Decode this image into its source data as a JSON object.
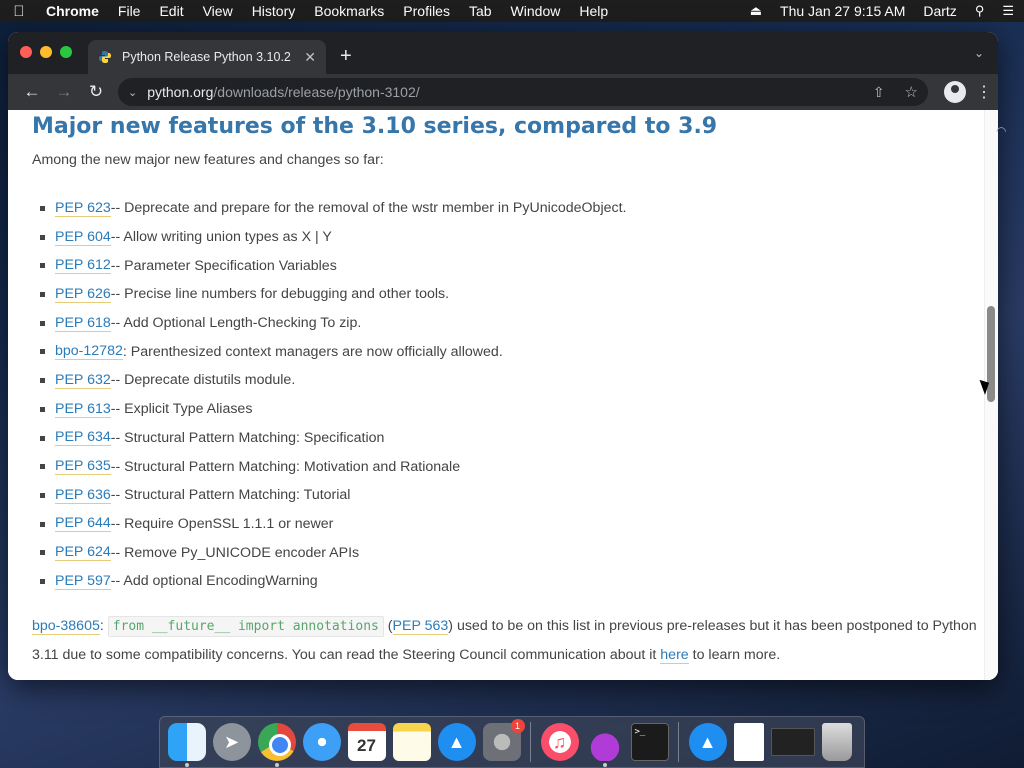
{
  "menubar": {
    "app_name": "Chrome",
    "menus": [
      "File",
      "Edit",
      "View",
      "History",
      "Bookmarks",
      "Profiles",
      "Tab",
      "Window",
      "Help"
    ],
    "datetime": "Thu Jan 27  9:15 AM",
    "user": "Dartz"
  },
  "browser": {
    "tab_title": "Python Release Python 3.10.2",
    "url_host": "python.org",
    "url_path": "/downloads/release/python-3102/"
  },
  "page": {
    "heading": "Major new features of the 3.10 series, compared to 3.9",
    "intro": "Among the new major new features and changes so far:",
    "features": [
      {
        "link": "PEP 623",
        "text": " -- Deprecate and prepare for the removal of the wstr member in PyUnicodeObject."
      },
      {
        "link": "PEP 604",
        "text": " -- Allow writing union types as X | Y"
      },
      {
        "link": "PEP 612",
        "text": " -- Parameter Specification Variables"
      },
      {
        "link": "PEP 626",
        "text": " -- Precise line numbers for debugging and other tools."
      },
      {
        "link": "PEP 618",
        "text": " -- Add Optional Length-Checking To zip."
      },
      {
        "link": "bpo-12782",
        "text": ": Parenthesized context managers are now officially allowed."
      },
      {
        "link": "PEP 632",
        "text": " -- Deprecate distutils module."
      },
      {
        "link": "PEP 613",
        "text": " -- Explicit Type Aliases"
      },
      {
        "link": "PEP 634",
        "text": " -- Structural Pattern Matching: Specification"
      },
      {
        "link": "PEP 635",
        "text": " -- Structural Pattern Matching: Motivation and Rationale"
      },
      {
        "link": "PEP 636",
        "text": " -- Structural Pattern Matching: Tutorial"
      },
      {
        "link": "PEP 644",
        "text": " -- Require OpenSSL 1.1.1 or newer"
      },
      {
        "link": "PEP 624",
        "text": " -- Remove Py_UNICODE encoder APIs"
      },
      {
        "link": "PEP 597",
        "text": " -- Add optional EncodingWarning"
      }
    ],
    "footer": {
      "bpo_link": "bpo-38605",
      "colon": ": ",
      "code": "from __future__ import annotations",
      "paren_open": " (",
      "pep_link": "PEP 563",
      "text_after": ") used to be on this list in previous pre-releases but it has been postponed to Python 3.11 due to some compatibility concerns. You can read the Steering Council communication about it ",
      "here_link": "here",
      "text_end": " to learn more."
    }
  },
  "dock": {
    "calendar_month": "JAN",
    "calendar_day": "27",
    "sysprefs_badge": "1",
    "terminal_prompt": ">_"
  },
  "colors": {
    "heading": "#3776ab",
    "link": "#2b7bb9",
    "code_text": "#59a56b"
  }
}
